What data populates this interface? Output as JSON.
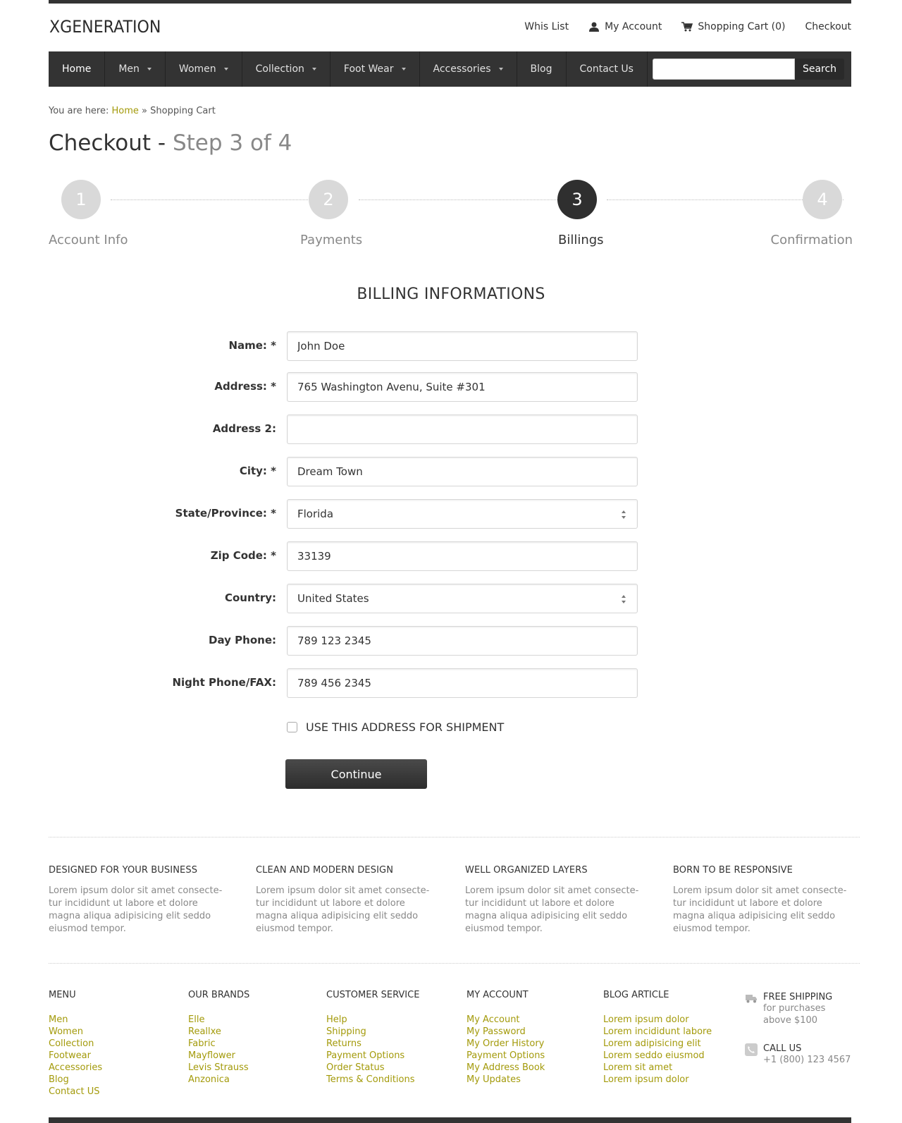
{
  "header": {
    "logo": "XGENERATION",
    "links": {
      "wishlist": "Whis List",
      "account": "My Account",
      "cart": "Shopping Cart (0)",
      "checkout": "Checkout"
    }
  },
  "nav": {
    "items": [
      "Home",
      "Men",
      "Women",
      "Collection",
      "Foot Wear",
      "Accessories",
      "Blog",
      "Contact Us"
    ],
    "search_button": "Search",
    "search_value": ""
  },
  "breadcrumb": {
    "prefix": "You are here:",
    "home": "Home",
    "sep": "»",
    "current": "Shopping Cart"
  },
  "title": {
    "main": "Checkout -",
    "step": "Step 3 of 4"
  },
  "steps": [
    {
      "num": "1",
      "label": "Account Info"
    },
    {
      "num": "2",
      "label": "Payments"
    },
    {
      "num": "3",
      "label": "Billings"
    },
    {
      "num": "4",
      "label": "Confirmation"
    }
  ],
  "active_step": 3,
  "form": {
    "title": "BILLING INFORMATIONS",
    "fields": {
      "name": {
        "label": "Name: *",
        "value": "John Doe"
      },
      "address": {
        "label": "Address: *",
        "value": "765 Washington Avenu, Suite #301"
      },
      "address2": {
        "label": "Address 2:",
        "value": ""
      },
      "city": {
        "label": "City: *",
        "value": "Dream Town"
      },
      "state": {
        "label": "State/Province: *",
        "value": "Florida"
      },
      "zip": {
        "label": "Zip Code: *",
        "value": "33139"
      },
      "country": {
        "label": "Country:",
        "value": "United States"
      },
      "day_phone": {
        "label": "Day Phone:",
        "value": "789 123 2345"
      },
      "night_phone": {
        "label": "Night Phone/FAX:",
        "value": "789 456 2345"
      }
    },
    "shipment_checkbox": "USE THIS ADDRESS FOR SHIPMENT",
    "shipment_checked": false,
    "continue": "Continue"
  },
  "features": [
    {
      "title": "DESIGNED FOR YOUR BUSINESS",
      "text": "Lorem ipsum dolor sit amet consecte-tur incididunt ut labore et dolore magna aliqua adipisicing elit seddo eiusmod tempor."
    },
    {
      "title": "CLEAN AND MODERN DESIGN",
      "text": "Lorem ipsum dolor sit amet consecte-tur incididunt ut labore et dolore magna aliqua adipisicing elit seddo eiusmod tempor."
    },
    {
      "title": "WELL ORGANIZED LAYERS",
      "text": "Lorem ipsum dolor sit amet consecte-tur incididunt ut labore et dolore magna aliqua adipisicing elit seddo eiusmod tempor."
    },
    {
      "title": "BORN TO BE RESPONSIVE",
      "text": "Lorem ipsum dolor sit amet consecte-tur incididunt ut labore et dolore magna aliqua adipisicing elit seddo eiusmod tempor."
    }
  ],
  "footer": {
    "menu": {
      "title": "MENU",
      "links": [
        "Men",
        "Women",
        "Collection",
        "Footwear",
        "Accessories",
        "Blog",
        "Contact US"
      ]
    },
    "brands": {
      "title": "OUR BRANDS",
      "links": [
        "Elle",
        "Reallxe",
        "Fabric",
        "Mayflower",
        "Levis Strauss",
        "Anzonica"
      ]
    },
    "service": {
      "title": "CUSTOMER SERVICE",
      "links": [
        "Help",
        "Shipping",
        "Returns",
        "Payment Options",
        "Order Status",
        "Terms & Conditions"
      ]
    },
    "account": {
      "title": "MY ACCOUNT",
      "links": [
        "My Account",
        "My Password",
        "My Order History",
        "Payment Options",
        "My Address Book",
        "My Updates"
      ]
    },
    "blog": {
      "title": "BLOG ARTICLE",
      "links": [
        "Lorem ipsum dolor",
        "Lorem incididunt labore",
        "Lorem adipisicing elit",
        "Lorem seddo eiusmod",
        "Lorem sit amet",
        "Lorem ipsum dolor"
      ]
    },
    "shipping": {
      "title": "FREE SHIPPING",
      "line1": "for purchases",
      "line2": "above $100"
    },
    "call": {
      "title": "CALL US",
      "phone": "+1 (800) 123 4567"
    }
  },
  "colors": {
    "accent": "#a39a0a",
    "dark": "#333333",
    "step_inactive": "#d9d9d9"
  },
  "icons": [
    "user-icon",
    "cart-icon",
    "truck-icon",
    "phone-icon",
    "select-arrows-icon"
  ]
}
